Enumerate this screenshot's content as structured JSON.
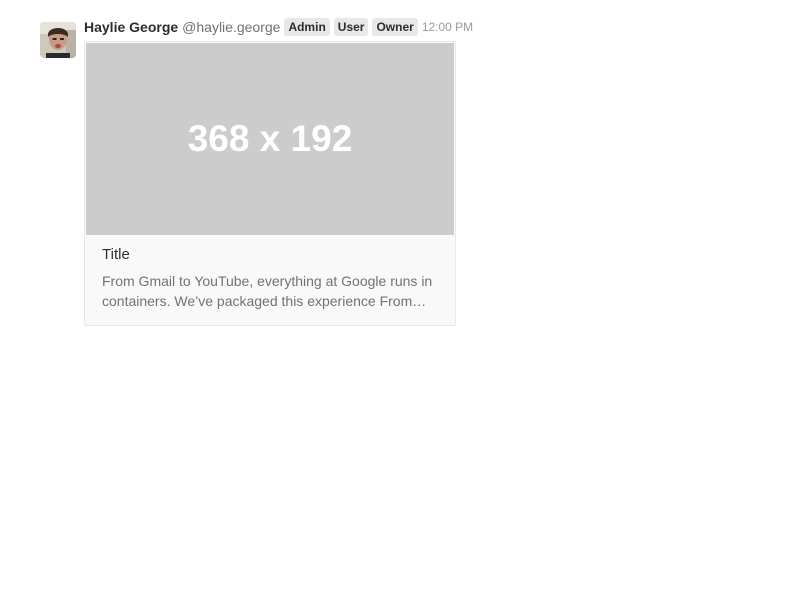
{
  "message": {
    "author": "Haylie George",
    "handle": "@haylie.george",
    "badges": [
      "Admin",
      "User",
      "Owner"
    ],
    "timestamp": "12:00 PM",
    "avatar_icon": "user-avatar-icon"
  },
  "card": {
    "preview_text": "368 x 192",
    "title": "Title",
    "description": "From Gmail to YouTube, everything at Google runs in containers. We’ve packaged this experience From…"
  }
}
